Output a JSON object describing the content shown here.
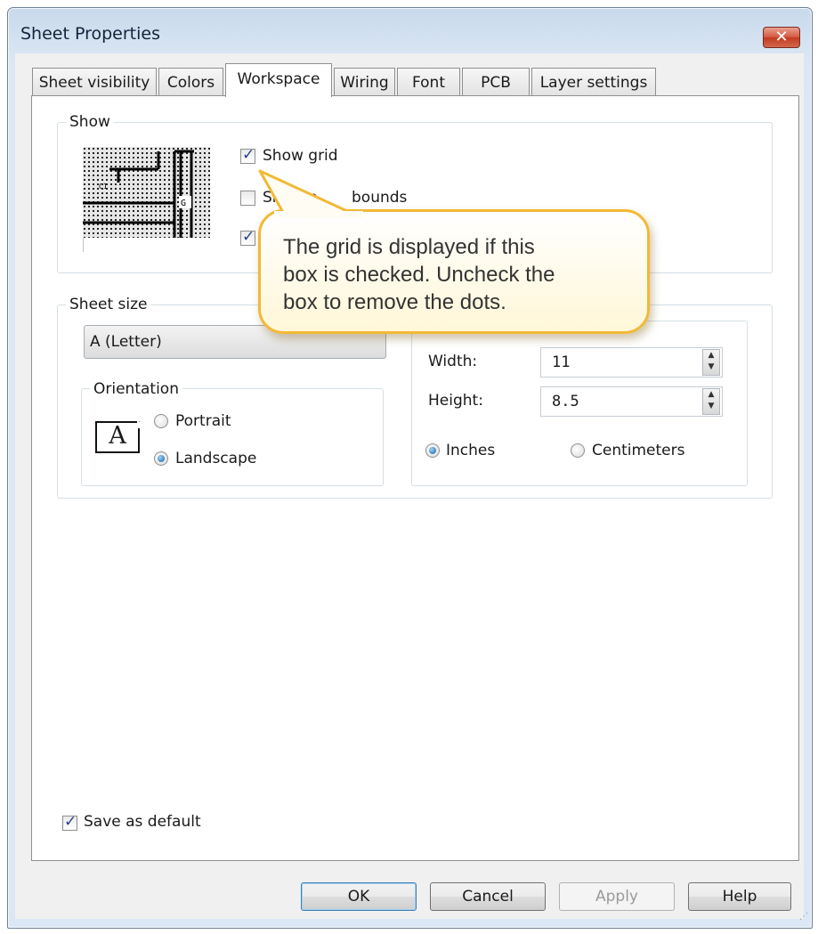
{
  "window": {
    "title": "Sheet Properties",
    "close_label": "✕"
  },
  "tabs": [
    "Sheet visibility",
    "Colors",
    "Workspace",
    "Wiring",
    "Font",
    "PCB",
    "Layer settings"
  ],
  "active_tab": "Workspace",
  "show_group": {
    "label": "Show",
    "show_grid": {
      "label": "Show grid",
      "checked": true
    },
    "show_page_bounds": {
      "label": "Show page bounds",
      "visible_label": "Show p",
      "checked": false
    },
    "third_checkbox": {
      "checked": true
    }
  },
  "sheet_size_group": {
    "label": "Sheet size",
    "selected": "A (Letter)",
    "orientation": {
      "label": "Orientation",
      "icon_letter": "A",
      "portrait": "Portrait",
      "landscape": "Landscape",
      "selected": "Landscape"
    },
    "width_label": "Width:",
    "width_value": "11",
    "height_label": "Height:",
    "height_value": "8.5",
    "units": {
      "inches": "Inches",
      "centimeters": "Centimeters",
      "selected": "Inches"
    }
  },
  "save_as_default": {
    "label": "Save as default",
    "checked": true
  },
  "buttons": {
    "ok": "OK",
    "cancel": "Cancel",
    "apply": "Apply",
    "help": "Help"
  },
  "callout": {
    "lines": [
      "The grid is displayed if this",
      "box is checked. Uncheck the",
      "box to remove the dots."
    ]
  },
  "colors": {
    "callout_border": "#f2b936",
    "radio_selected": "#0f5fa8",
    "checkmark": "#2b3f88"
  }
}
